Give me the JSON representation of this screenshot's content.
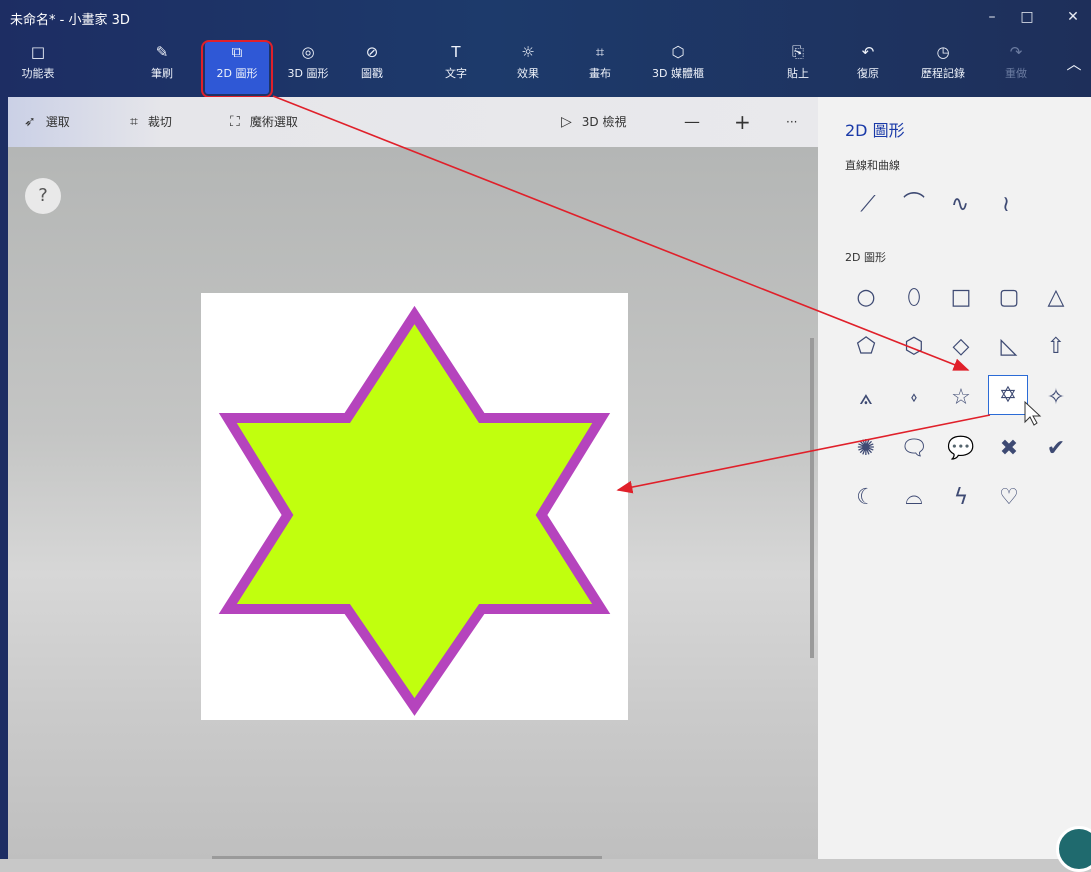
{
  "window": {
    "title": "未命名* - 小畫家 3D",
    "minimize": "–",
    "maximize": "□",
    "close": "✕"
  },
  "ribbon": [
    {
      "label": "功能表",
      "icon": "□"
    },
    {
      "label": "筆刷",
      "icon": "✎"
    },
    {
      "label": "2D 圖形",
      "icon": "⧉"
    },
    {
      "label": "3D 圖形",
      "icon": "◎"
    },
    {
      "label": "圖戳",
      "icon": "⊘"
    },
    {
      "label": "文字",
      "icon": "T"
    },
    {
      "label": "效果",
      "icon": "☼"
    },
    {
      "label": "畫布",
      "icon": "⌗"
    },
    {
      "label": "3D 媒體櫃",
      "icon": "⬡"
    },
    {
      "label": "貼上",
      "icon": "⎘"
    },
    {
      "label": "復原",
      "icon": "↶"
    },
    {
      "label": "歷程記錄",
      "icon": "◷"
    },
    {
      "label": "重做",
      "icon": "↷"
    },
    {
      "label": "",
      "icon": "︿"
    }
  ],
  "toolbar": {
    "select": "選取",
    "select_icon": "➶",
    "crop": "裁切",
    "crop_icon": "⌗",
    "magic": "魔術選取",
    "magic_icon": "⛶",
    "view3d": "3D 檢視",
    "view3d_icon": "▷",
    "zoom_out": "—",
    "zoom_in": "+",
    "more": "···"
  },
  "help": "?",
  "panel": {
    "title": "2D 圖形",
    "section_lines": "直線和曲線",
    "section_shapes": "2D 圖形",
    "lines": [
      "⟋",
      "⌒",
      "∿",
      "≀"
    ],
    "shapes": [
      [
        "○",
        "⬯",
        "□",
        "▢",
        "△"
      ],
      [
        "⬠",
        "⬡",
        "◇",
        "◺",
        "⇧"
      ],
      [
        "⟑",
        "⬫",
        "☆",
        "✡",
        "✧"
      ],
      [
        "✺",
        "🗨",
        "💬",
        "✖",
        "✔"
      ],
      [
        "☾",
        "⌓",
        "ϟ",
        "♡"
      ]
    ],
    "selected_shape": "✡"
  },
  "canvas": {
    "star_fill": "#c1ff0e",
    "star_stroke": "#b544bd",
    "paper": "#ffffff"
  },
  "colors": {
    "accent": "#2f58d6",
    "highlight": "#e0202a",
    "titlebar": "#1d2d63"
  }
}
